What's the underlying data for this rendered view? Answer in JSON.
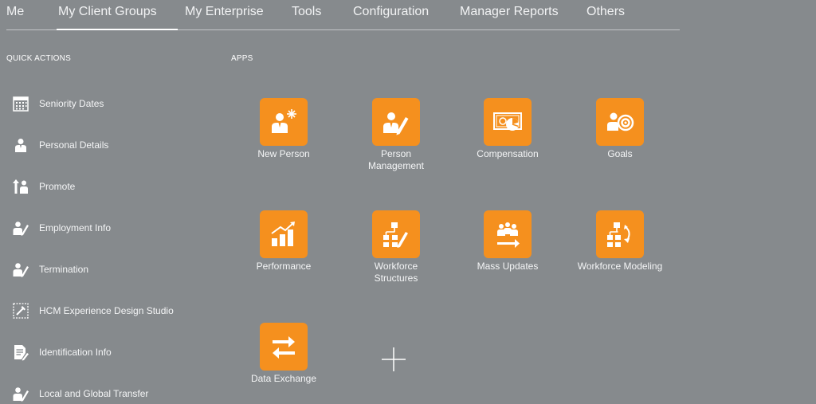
{
  "nav": {
    "tabs": [
      "Me",
      "My Client Groups",
      "My Enterprise",
      "Tools",
      "Configuration",
      "Manager Reports",
      "Others"
    ],
    "active_index": 1
  },
  "quick_actions": {
    "title": "QUICK ACTIONS",
    "items": [
      {
        "label": "Seniority Dates",
        "icon": "calendar-icon"
      },
      {
        "label": "Personal Details",
        "icon": "person-icon"
      },
      {
        "label": "Promote",
        "icon": "promote-icon"
      },
      {
        "label": "Employment Info",
        "icon": "person-edit-icon"
      },
      {
        "label": "Termination",
        "icon": "person-edit-icon"
      },
      {
        "label": "HCM Experience Design Studio",
        "icon": "design-studio-icon"
      },
      {
        "label": "Identification Info",
        "icon": "document-edit-icon"
      },
      {
        "label": "Local and Global Transfer",
        "icon": "person-edit-icon"
      }
    ]
  },
  "apps": {
    "title": "APPS",
    "items": [
      {
        "label": "New Person",
        "icon": "new-person-icon"
      },
      {
        "label": "Person Management",
        "icon": "person-management-icon"
      },
      {
        "label": "Compensation",
        "icon": "compensation-icon"
      },
      {
        "label": "Goals",
        "icon": "goals-icon"
      },
      {
        "label": "Performance",
        "icon": "performance-icon"
      },
      {
        "label": "Workforce Structures",
        "icon": "workforce-structures-icon"
      },
      {
        "label": "Mass Updates",
        "icon": "mass-updates-icon"
      },
      {
        "label": "Workforce Modeling",
        "icon": "workforce-modeling-icon"
      },
      {
        "label": "Data Exchange",
        "icon": "data-exchange-icon"
      }
    ]
  },
  "colors": {
    "background": "#868a8d",
    "tile": "#f5901e",
    "text": "#ffffff"
  }
}
